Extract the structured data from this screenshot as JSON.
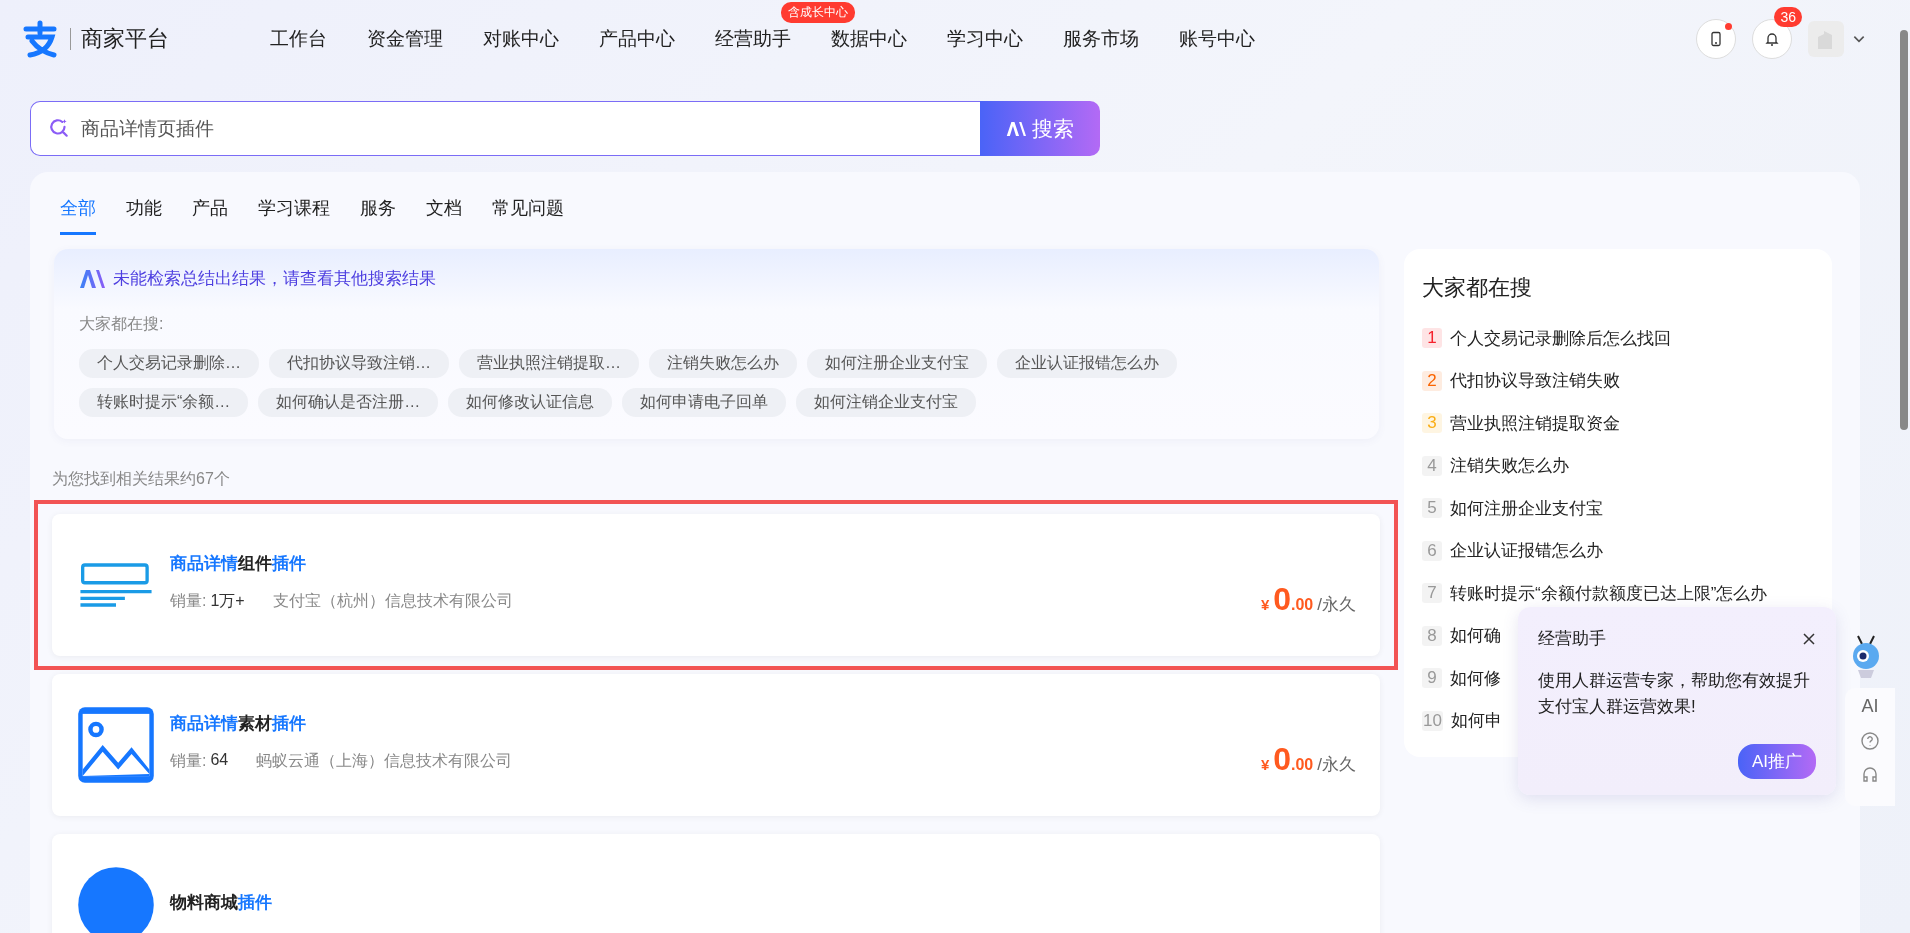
{
  "header": {
    "brand": "商家平台",
    "nav": [
      {
        "label": "工作台"
      },
      {
        "label": "资金管理"
      },
      {
        "label": "对账中心"
      },
      {
        "label": "产品中心"
      },
      {
        "label": "经营助手",
        "badge": "含成长中心"
      },
      {
        "label": "数据中心"
      },
      {
        "label": "学习中心"
      },
      {
        "label": "服务市场"
      },
      {
        "label": "账号中心"
      }
    ],
    "phone_dot": true,
    "notification_count": "36"
  },
  "search": {
    "value": "商品详情页插件",
    "button": "搜索"
  },
  "tabs": [
    {
      "label": "全部",
      "selected": true
    },
    {
      "label": "功能",
      "selected": false
    },
    {
      "label": "产品",
      "selected": false
    },
    {
      "label": "学习课程",
      "selected": false
    },
    {
      "label": "服务",
      "selected": false
    },
    {
      "label": "文档",
      "selected": false
    },
    {
      "label": "常见问题",
      "selected": false
    }
  ],
  "ai_box": {
    "message": "未能检索总结出结果，请查看其他搜索结果",
    "label": "大家都在搜:",
    "chips": [
      "个人交易记录删除…",
      "代扣协议导致注销…",
      "营业执照注销提取…",
      "注销失败怎么办",
      "如何注册企业支付宝",
      "企业认证报错怎么办",
      "转账时提示“余额…",
      "如何确认是否注册…",
      "如何修改认证信息",
      "如何申请电子回单",
      "如何注销企业支付宝"
    ]
  },
  "result_count": "为您找到相关结果约67个",
  "results": [
    {
      "kind": "layout",
      "outlined": true,
      "title": [
        {
          "text": "商品详情",
          "highlight": true
        },
        {
          "text": "组件",
          "highlight": false
        },
        {
          "text": "插件",
          "highlight": true
        }
      ],
      "sales_label": "销量:",
      "sales": "1万+",
      "vendor": "支付宝（杭州）信息技术有限公司",
      "currency": "¥",
      "price": "0",
      "cents": ".00",
      "period": "/永久"
    },
    {
      "kind": "image",
      "outlined": false,
      "title": [
        {
          "text": "商品详情",
          "highlight": true
        },
        {
          "text": "素材",
          "highlight": false
        },
        {
          "text": "插件",
          "highlight": true
        }
      ],
      "sales_label": "销量:",
      "sales": "64",
      "vendor": "蚂蚁云通（上海）信息技术有限公司",
      "currency": "¥",
      "price": "0",
      "cents": ".00",
      "period": "/永久"
    },
    {
      "kind": "circle",
      "outlined": false,
      "title": [
        {
          "text": "物料商城",
          "highlight": false
        },
        {
          "text": "插件",
          "highlight": true
        }
      ]
    }
  ],
  "hot": {
    "title": "大家都在搜",
    "items": [
      {
        "rank": "1",
        "text": "个人交易记录删除后怎么找回",
        "color": "#f5222d"
      },
      {
        "rank": "2",
        "text": "代扣协议导致注销失败",
        "color": "#fa6400"
      },
      {
        "rank": "3",
        "text": "营业执照注销提取资金",
        "color": "#faad14"
      },
      {
        "rank": "4",
        "text": "注销失败怎么办",
        "color": "#999999"
      },
      {
        "rank": "5",
        "text": "如何注册企业支付宝",
        "color": "#999999"
      },
      {
        "rank": "6",
        "text": "企业认证报错怎么办",
        "color": "#999999"
      },
      {
        "rank": "7",
        "text": "转账时提示“余额付款额度已达上限”怎么办",
        "color": "#999999"
      },
      {
        "rank": "8",
        "text": "如何确",
        "color": "#999999"
      },
      {
        "rank": "9",
        "text": "如何修",
        "color": "#999999"
      },
      {
        "rank": "10",
        "text": "如何申",
        "color": "#999999"
      }
    ]
  },
  "assistant": {
    "title": "经营助手",
    "message": "使用人群运营专家，帮助您有效提升支付宝人群运营效果!",
    "button": "AI推广"
  },
  "side_tools": {
    "ai": "AI"
  }
}
